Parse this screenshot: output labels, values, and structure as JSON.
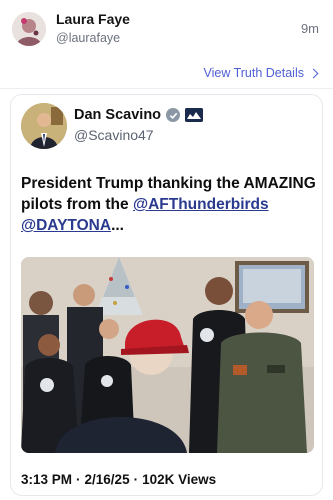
{
  "post": {
    "author_name": "Laura Faye",
    "author_handle": "@laurafaye",
    "time_ago": "9m",
    "view_details_label": "View Truth Details"
  },
  "quoted": {
    "name": "Dan Scavino",
    "handle": "@Scavino47",
    "text_prefix": "President Trump thanking the AMAZING pilots from the ",
    "mention_1": "@AFThunderbirds",
    "mention_2": "@DAYTONA",
    "ellipsis": "...",
    "time": "3:13 PM",
    "date": "2/16/25",
    "separator": "·",
    "views": "102K Views"
  },
  "icons": {
    "verified": "verified-badge-icon",
    "flag": "flag-icon",
    "chevron": "chevron-right-icon"
  },
  "colors": {
    "accent": "#4f5fd6",
    "mention": "#2a3a8f",
    "muted": "#6d7280"
  }
}
